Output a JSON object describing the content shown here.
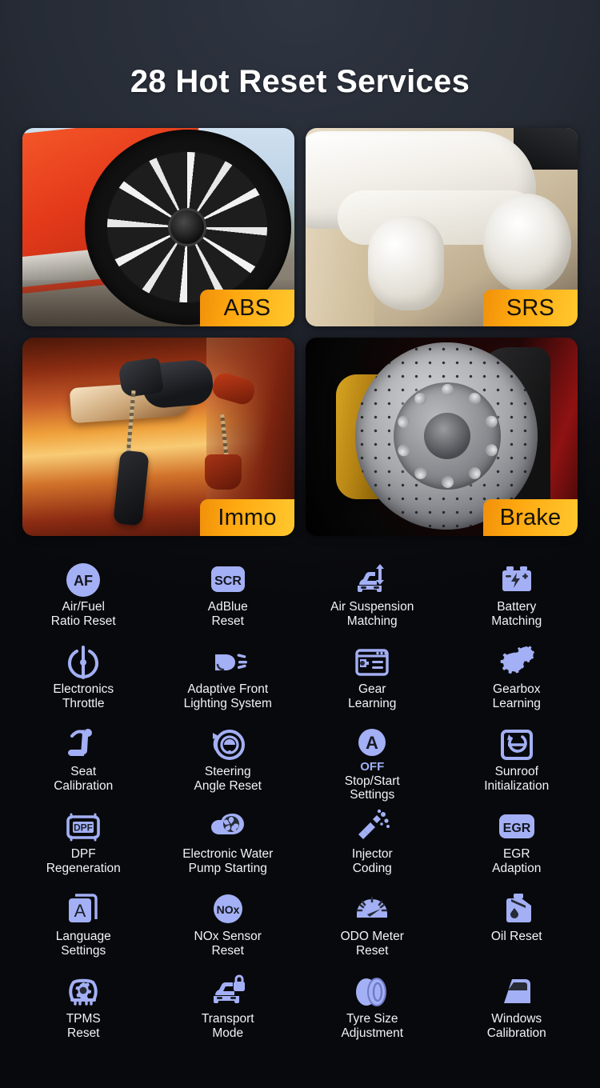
{
  "header": {
    "title": "28 Hot Reset Services"
  },
  "theme": {
    "icon_color": "#A3B0F5",
    "badge_gradient_start": "#F0900B",
    "badge_gradient_end": "#FFC82E",
    "background_top": "#2F3541",
    "background_bottom": "#08090C",
    "caption_color": "#F2F3F5"
  },
  "cards": [
    {
      "badge": "ABS",
      "icon": "car-wheel-photo"
    },
    {
      "badge": "SRS",
      "icon": "airbag-photo"
    },
    {
      "badge": "Immo",
      "icon": "car-key-lock-photo"
    },
    {
      "badge": "Brake",
      "icon": "brake-disc-photo"
    }
  ],
  "services": [
    {
      "icon": "af-badge-icon",
      "line1": "Air/Fuel",
      "line2": "Ratio Reset"
    },
    {
      "icon": "scr-badge-icon",
      "line1": "AdBlue",
      "line2": "Reset"
    },
    {
      "icon": "air-suspension-icon",
      "line1": "Air Suspension",
      "line2": "Matching"
    },
    {
      "icon": "battery-icon",
      "line1": "Battery",
      "line2": "Matching"
    },
    {
      "icon": "throttle-icon",
      "line1": "Electronics",
      "line2": "Throttle"
    },
    {
      "icon": "headlight-icon",
      "line1": "Adaptive Front",
      "line2": "Lighting System"
    },
    {
      "icon": "gear-panel-icon",
      "line1": "Gear",
      "line2": "Learning"
    },
    {
      "icon": "gears-icon",
      "line1": "Gearbox",
      "line2": "Learning"
    },
    {
      "icon": "car-seat-icon",
      "line1": "Seat",
      "line2": "Calibration"
    },
    {
      "icon": "steering-wheel-icon",
      "line1": "Steering",
      "line2": "Angle Reset"
    },
    {
      "icon": "auto-stop-start-icon",
      "sub": "OFF",
      "line1": "Stop/Start",
      "line2": "Settings"
    },
    {
      "icon": "sunroof-icon",
      "line1": "Sunroof",
      "line2": "Initialization"
    },
    {
      "icon": "dpf-badge-icon",
      "line1": "DPF",
      "line2": "Regeneration"
    },
    {
      "icon": "water-pump-icon",
      "line1": "Electronic Water",
      "line2": "Pump Starting"
    },
    {
      "icon": "injector-icon",
      "line1": "Injector",
      "line2": "Coding"
    },
    {
      "icon": "egr-badge-icon",
      "line1": "EGR",
      "line2": "Adaption"
    },
    {
      "icon": "language-book-icon",
      "line1": "Language",
      "line2": "Settings"
    },
    {
      "icon": "nox-badge-icon",
      "line1": "NOx Sensor",
      "line2": "Reset"
    },
    {
      "icon": "odometer-icon",
      "line1": "ODO Meter",
      "line2": "Reset"
    },
    {
      "icon": "oil-can-icon",
      "line1": "Oil Reset",
      "line2": ""
    },
    {
      "icon": "tpms-icon",
      "line1": "TPMS",
      "line2": "Reset"
    },
    {
      "icon": "transport-lock-icon",
      "line1": "Transport",
      "line2": "Mode"
    },
    {
      "icon": "tyre-icon",
      "line1": "Tyre Size",
      "line2": "Adjustment"
    },
    {
      "icon": "car-door-window-icon",
      "line1": "Windows",
      "line2": "Calibration"
    }
  ]
}
